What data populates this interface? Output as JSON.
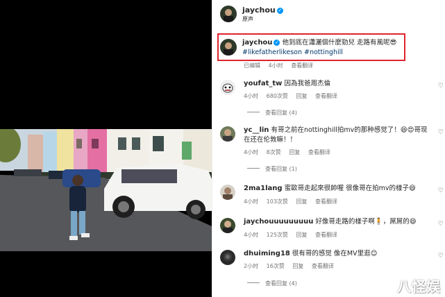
{
  "post": {
    "author": "jaychou",
    "subtitle": "原声",
    "caption_user": "jaychou",
    "caption_text": "他到底在瀟灑個什麼勁兒 走路有風呢😎",
    "hashtag_1": "#likefatherlikeson",
    "hashtag_2": "#nottinghill",
    "caption_edited": "已编辑",
    "caption_time": "4小时",
    "caption_translate": "查看翻译"
  },
  "comments": [
    {
      "user": "youfat_tw",
      "text": "因為我爸周杰倫",
      "time": "4小时",
      "likes": "680次赞",
      "reply": "回复",
      "translate": "查看翻译",
      "view_replies": "查看回复 (4)"
    },
    {
      "user": "yc__lin",
      "text": "有哥之前在nottinghill拍mv的那种感觉了！😆😍哥现在还在伦敦嘛！！",
      "time": "4小时",
      "likes": "8次赞",
      "reply": "回复",
      "translate": "查看翻译",
      "view_replies": "查看回复 (1)"
    },
    {
      "user": "2ma1lang",
      "text": "蜜歐哥走起來很帥喔 很像哥在拍mv的樣子😄",
      "time": "4小时",
      "likes": "103次赞",
      "reply": "回复",
      "translate": "查看翻译"
    },
    {
      "user": "jaychouuuuuuuuu",
      "text": "好像哥走路的樣子啊🧍，屌屌的😄",
      "time": "4小时",
      "likes": "125次赞",
      "reply": "回复",
      "translate": "查看翻译"
    },
    {
      "user": "dhuiming18",
      "text": "很有哥的感觉 像在MV里逛😊",
      "time": "2小时",
      "likes": "16次赞",
      "reply": "回复",
      "translate": "查看翻译",
      "view_replies": "查看回复 (4)"
    }
  ],
  "watermark": "八怪娱",
  "colors": {
    "highlight": "#e0232e",
    "verified": "#0095f6",
    "hashtag": "#00376b"
  },
  "icons": [
    "verified-badge-icon",
    "heart-icon"
  ]
}
